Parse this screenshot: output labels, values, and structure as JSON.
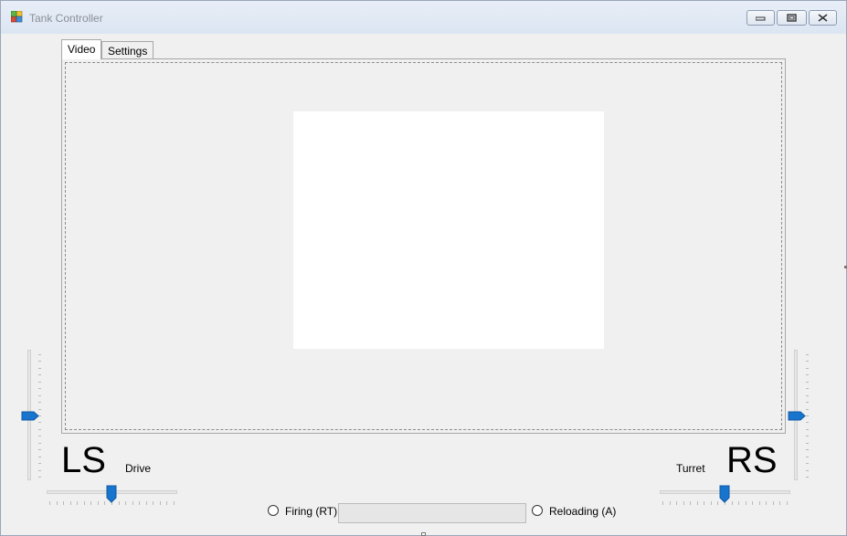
{
  "window": {
    "title": "Tank Controller",
    "icon": "app-icon",
    "controls": [
      "minimize-icon",
      "restore-icon",
      "close-icon"
    ]
  },
  "tabs": [
    {
      "label": "Video",
      "active": true
    },
    {
      "label": "Settings",
      "active": false
    }
  ],
  "video": {
    "content": "blank"
  },
  "left_stick": {
    "big_label": "LS",
    "small_label": "Drive",
    "vertical_slider_value": 0.5,
    "horizontal_slider_value": 0.5
  },
  "right_stick": {
    "big_label": "RS",
    "small_label": "Turret",
    "vertical_slider_value": 0.5,
    "horizontal_slider_value": 0.5
  },
  "status": {
    "firing_label": "Firing (RT)",
    "firing_checked": false,
    "reloading_label": "Reloading (A)",
    "reloading_checked": false,
    "reload_progress": 0
  },
  "colors": {
    "slider_thumb": "#1874cd",
    "title_text": "#8a8f96"
  }
}
